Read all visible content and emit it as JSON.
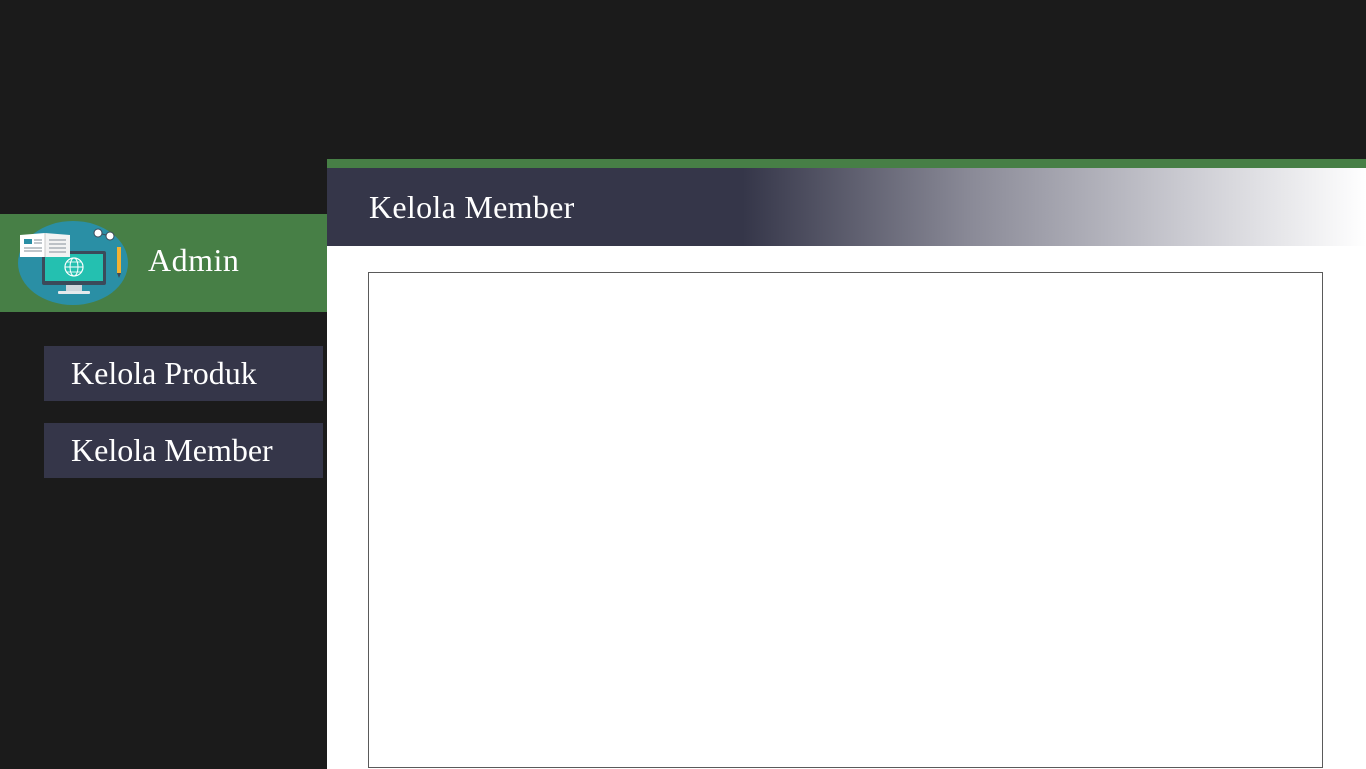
{
  "sidebar": {
    "profile": {
      "label": "Admin",
      "avatar_icon": "computer-education-icon",
      "background_color": "#477f46"
    },
    "menu": [
      {
        "label": "Kelola Produk"
      },
      {
        "label": "Kelola Member"
      }
    ],
    "menu_color": "#353649"
  },
  "main": {
    "title": "Kelola Member",
    "accent_color": "#477f46",
    "title_bar_color": "#353649"
  }
}
